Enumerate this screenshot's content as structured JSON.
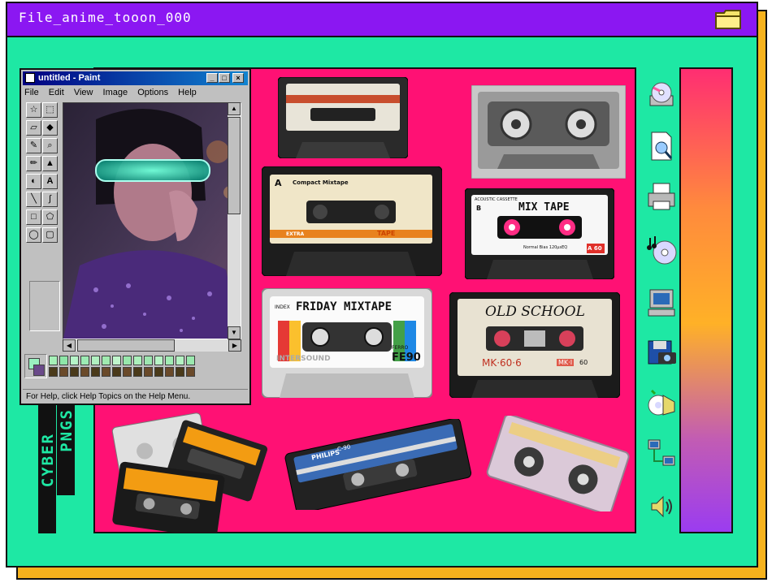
{
  "window": {
    "title": "File_anime_tooon_000"
  },
  "sidebar_text": {
    "line1": "CYBER",
    "line2": "PNGS"
  },
  "paint": {
    "title": "untitled - Paint",
    "menu": [
      "File",
      "Edit",
      "View",
      "Image",
      "Options",
      "Help"
    ],
    "status": "For Help, click Help Topics on the Help Menu.",
    "tools": [
      "free-select",
      "rect-select",
      "eraser",
      "fill",
      "color-picker",
      "magnifier",
      "pencil",
      "brush",
      "airbrush",
      "text",
      "line",
      "curve",
      "rectangle",
      "polygon",
      "ellipse",
      "rounded-rect"
    ],
    "palette": [
      "#000000",
      "#808080",
      "#800000",
      "#808000",
      "#008000",
      "#008080",
      "#000080",
      "#800080",
      "#808040",
      "#004040",
      "#0080ff",
      "#004080",
      "#8000ff",
      "#804000"
    ]
  },
  "cassettes": {
    "friday": {
      "index": "INDEX",
      "title": "FRIDAY MIXTAPE",
      "brand": "INTERSOUND",
      "type": "FERRO",
      "model": "FE90"
    },
    "mixtape": {
      "title": "MIX TAPE",
      "side": "B",
      "small": "ACOUSTIC CASSETTE",
      "sub": "Normal Bias 120µsEQ",
      "length": "A 60"
    },
    "oldschool": {
      "title": "OLD SCHOOL",
      "model": "MK·60·6",
      "tag1": "MK·I",
      "tag2": "60"
    },
    "compact": {
      "side": "A",
      "brand": "Compact Mixtape",
      "tape": "TAPE",
      "label": "EXTRA"
    },
    "philips": {
      "brand": "PHILIPS",
      "model": "C-90"
    }
  },
  "icons": [
    "cd-drive-icon",
    "search-file-icon",
    "printer-icon",
    "music-cd-icon",
    "computer-icon",
    "camera-disk-icon",
    "media-player-icon",
    "network-icon",
    "speaker-icon"
  ],
  "colors": {
    "accent_green": "#1ee8a4",
    "pink": "#ff1174",
    "purple": "#8b17f2",
    "orange": "#f6b21c"
  }
}
